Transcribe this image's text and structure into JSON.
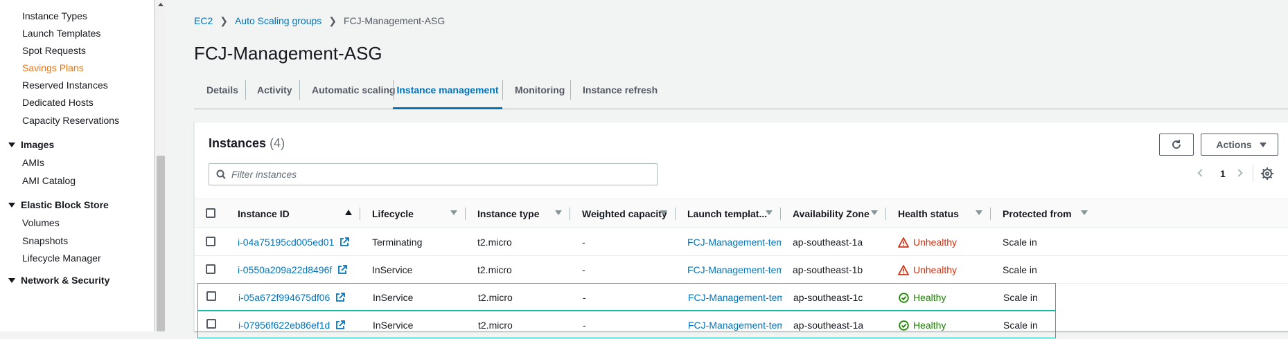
{
  "sidebar": {
    "items": [
      {
        "label": "Instance Types"
      },
      {
        "label": "Launch Templates"
      },
      {
        "label": "Spot Requests"
      },
      {
        "label": "Savings Plans"
      },
      {
        "label": "Reserved Instances"
      },
      {
        "label": "Dedicated Hosts"
      },
      {
        "label": "Capacity Reservations"
      }
    ],
    "images_section": "Images",
    "images_items": [
      {
        "label": "AMIs"
      },
      {
        "label": "AMI Catalog"
      }
    ],
    "ebs_section": "Elastic Block Store",
    "ebs_items": [
      {
        "label": "Volumes"
      },
      {
        "label": "Snapshots"
      },
      {
        "label": "Lifecycle Manager"
      }
    ],
    "next_section": "Network & Security"
  },
  "breadcrumb": {
    "items": [
      "EC2",
      "Auto Scaling groups"
    ],
    "current": "FCJ-Management-ASG"
  },
  "page_title": "FCJ-Management-ASG",
  "tabs": [
    {
      "label": "Details"
    },
    {
      "label": "Activity"
    },
    {
      "label": "Automatic scaling"
    },
    {
      "label": "Instance management"
    },
    {
      "label": "Monitoring"
    },
    {
      "label": "Instance refresh"
    }
  ],
  "panel": {
    "title": "Instances",
    "count": "(4)",
    "actions_label": "Actions",
    "filter_placeholder": "Filter instances",
    "page": "1"
  },
  "table": {
    "columns": [
      "Instance ID",
      "Lifecycle",
      "Instance type",
      "Weighted capacity",
      "Launch templat...",
      "Availability Zone",
      "Health status",
      "Protected from"
    ],
    "rows": [
      {
        "id": "i-04a75195cd005ed01",
        "lifecycle": "Terminating",
        "type": "t2.micro",
        "weighted": "-",
        "template": "FCJ-Management-template",
        "az": "ap-southeast-1a",
        "health": "Unhealthy",
        "protected": "Scale in"
      },
      {
        "id": "i-0550a209a22d8496f",
        "lifecycle": "InService",
        "type": "t2.micro",
        "weighted": "-",
        "template": "FCJ-Management-template",
        "az": "ap-southeast-1b",
        "health": "Unhealthy",
        "protected": "Scale in"
      },
      {
        "id": "i-05a672f994675df06",
        "lifecycle": "InService",
        "type": "t2.micro",
        "weighted": "-",
        "template": "FCJ-Management-template",
        "az": "ap-southeast-1c",
        "health": "Healthy",
        "protected": "Scale in"
      },
      {
        "id": "i-07956f622eb86ef1d",
        "lifecycle": "InService",
        "type": "t2.micro",
        "weighted": "-",
        "template": "FCJ-Management-template",
        "az": "ap-southeast-1a",
        "health": "Healthy",
        "protected": "Scale in"
      }
    ]
  },
  "colors": {
    "link": "#0073bb",
    "active_nav": "#ec7211",
    "unhealthy": "#d13212",
    "healthy": "#1d8102",
    "selected_border": "#16b9a1"
  }
}
